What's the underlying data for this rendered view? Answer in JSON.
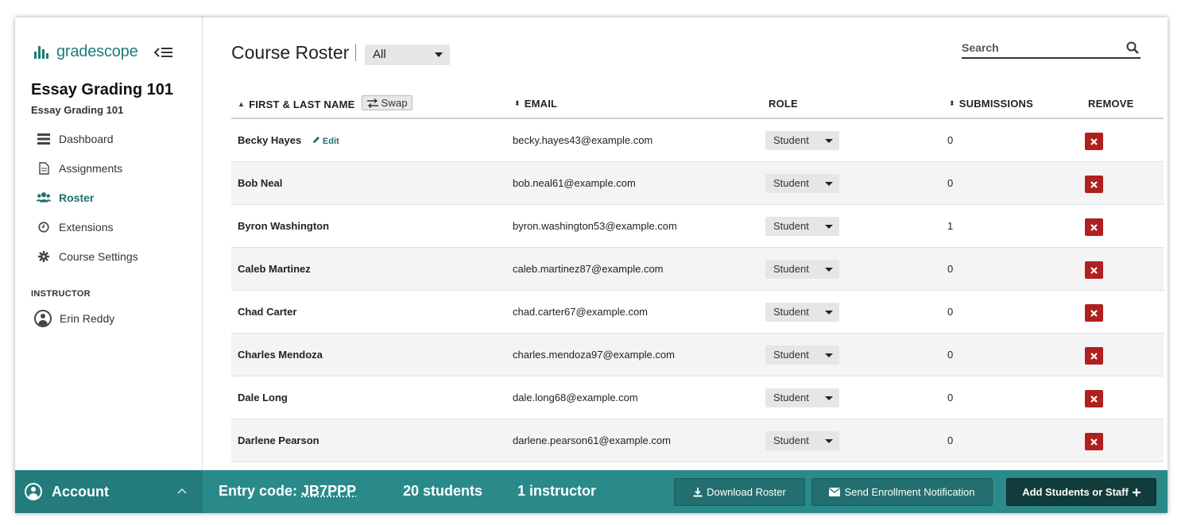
{
  "brand": {
    "name": "gradescope"
  },
  "course": {
    "title": "Essay Grading 101",
    "subtitle": "Essay Grading 101"
  },
  "sidebar": {
    "items": [
      {
        "label": "Dashboard",
        "icon": "dashboard-icon"
      },
      {
        "label": "Assignments",
        "icon": "document-icon"
      },
      {
        "label": "Roster",
        "icon": "users-icon",
        "active": true
      },
      {
        "label": "Extensions",
        "icon": "clock-icon"
      },
      {
        "label": "Course Settings",
        "icon": "gear-icon"
      }
    ],
    "section_label": "INSTRUCTOR",
    "instructor_name": "Erin Reddy"
  },
  "main": {
    "title": "Course Roster",
    "filter_value": "All",
    "search_placeholder": "Search"
  },
  "table": {
    "headers": {
      "name": "FIRST & LAST NAME",
      "swap": "Swap",
      "email": "EMAIL",
      "role": "ROLE",
      "submissions": "SUBMISSIONS",
      "remove": "REMOVE"
    },
    "edit_label": "Edit",
    "rows": [
      {
        "name": "Becky Hayes",
        "email": "becky.hayes43@example.com",
        "role": "Student",
        "submissions": "0"
      },
      {
        "name": "Bob Neal",
        "email": "bob.neal61@example.com",
        "role": "Student",
        "submissions": "0"
      },
      {
        "name": "Byron Washington",
        "email": "byron.washington53@example.com",
        "role": "Student",
        "submissions": "1"
      },
      {
        "name": "Caleb Martinez",
        "email": "caleb.martinez87@example.com",
        "role": "Student",
        "submissions": "0"
      },
      {
        "name": "Chad Carter",
        "email": "chad.carter67@example.com",
        "role": "Student",
        "submissions": "0"
      },
      {
        "name": "Charles Mendoza",
        "email": "charles.mendoza97@example.com",
        "role": "Student",
        "submissions": "0"
      },
      {
        "name": "Dale Long",
        "email": "dale.long68@example.com",
        "role": "Student",
        "submissions": "0"
      },
      {
        "name": "Darlene Pearson",
        "email": "darlene.pearson61@example.com",
        "role": "Student",
        "submissions": "0"
      }
    ]
  },
  "bottom_bar": {
    "account_label": "Account",
    "entry_code_label": "Entry code:",
    "entry_code": "JB7PPP",
    "students_count": "20 students",
    "instructor_count": "1 instructor",
    "download_label": "Download Roster",
    "notify_label": "Send Enrollment Notification",
    "add_label": "Add Students or Staff"
  },
  "colors": {
    "brand_teal": "#1f7a7a",
    "bottom_bar": "#2a8a8a",
    "remove_red": "#b02020",
    "add_button": "#123c3c"
  }
}
